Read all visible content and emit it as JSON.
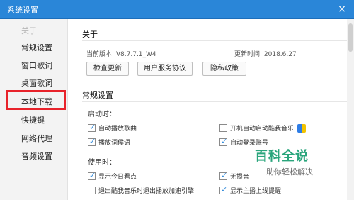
{
  "window": {
    "title": "系统设置",
    "close_glyph": "×"
  },
  "sidebar": {
    "items": [
      {
        "label": "关于",
        "state": "disabled"
      },
      {
        "label": "常规设置"
      },
      {
        "label": "窗口歌词"
      },
      {
        "label": "桌面歌词",
        "highlighted": true
      },
      {
        "label": "本地下载"
      },
      {
        "label": "快捷键"
      },
      {
        "label": "网络代理"
      },
      {
        "label": "音频设置"
      }
    ]
  },
  "about": {
    "title": "关于",
    "current_version": "当前版本: V8.7.7.1_W4",
    "updated_time": "更新时间: 2018.6.27",
    "buttons": {
      "check_update": "检查更新",
      "user_agreement": "用户服务协议",
      "privacy_policy": "隐私政策"
    }
  },
  "general": {
    "title": "常规设置",
    "startup_title": "启动时：",
    "startup": [
      {
        "label": "自动播放歌曲",
        "checked": true
      },
      {
        "label": "开机自动启动酷我音乐",
        "checked": false,
        "icon": "shield-icon"
      },
      {
        "label": "播放词候语",
        "checked": true
      },
      {
        "label": "自动登录账号",
        "checked": true
      }
    ],
    "usage_title": "使用时：",
    "usage": [
      {
        "label": "显示今日看点",
        "checked": true
      },
      {
        "label": "无损音",
        "checked": true
      },
      {
        "label": "退出酷我音乐时退出播放加速引擎",
        "checked": false
      },
      {
        "label": "显示主播上线提醒",
        "checked": true
      }
    ]
  },
  "watermark": {
    "title": "百科全说",
    "subtitle": "助你轻松解决"
  },
  "colors": {
    "titlebar": "#2a86d8",
    "highlight": "#e8232b",
    "accent": "#2aa57c"
  }
}
